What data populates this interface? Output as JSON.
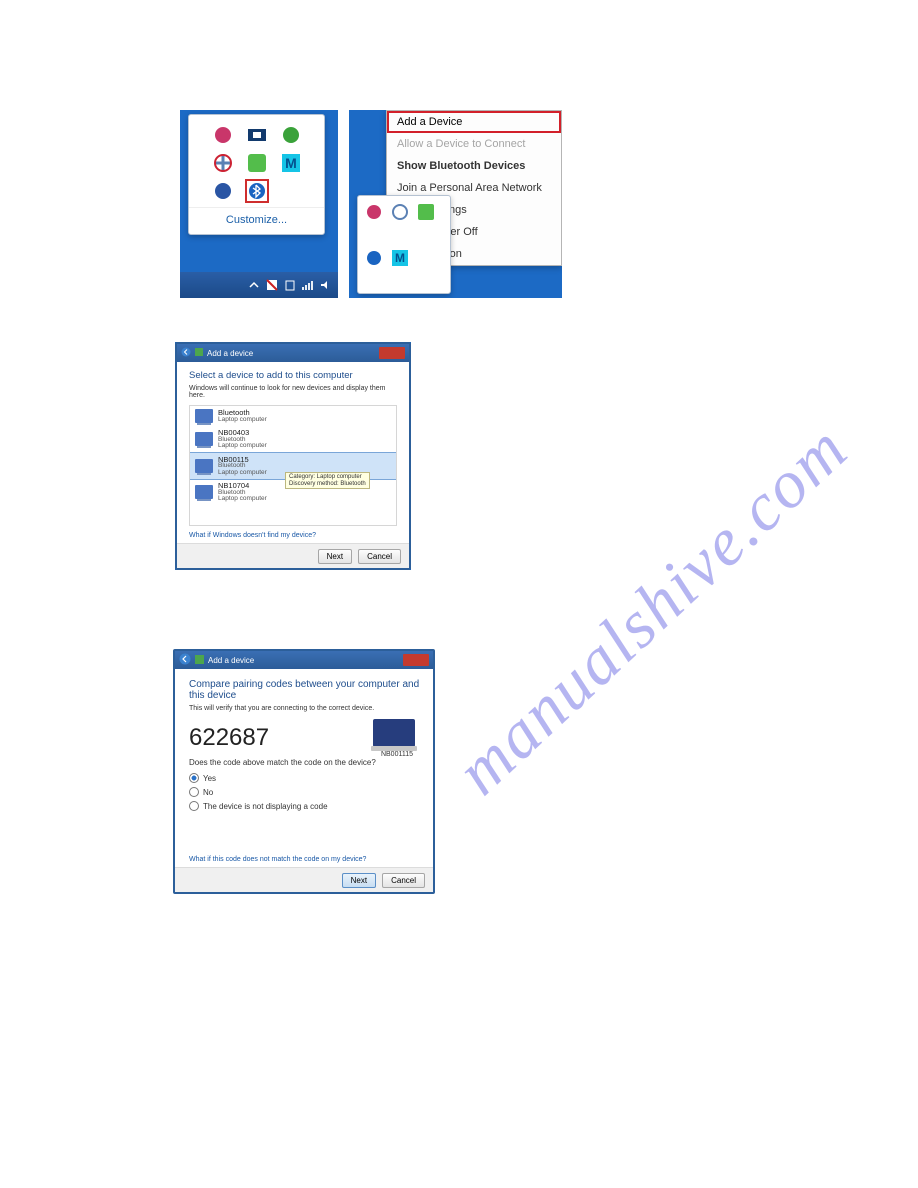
{
  "watermark": "manualshive.com",
  "shot1": {
    "customize": "Customize...",
    "icons": [
      "app1",
      "app2",
      "app3",
      "app4",
      "app5",
      "M-icon",
      "globe",
      "bluetooth"
    ]
  },
  "shot2": {
    "menu": [
      "Add a Device",
      "Allow a Device to Connect",
      "Show Bluetooth Devices",
      "Join a Personal Area Network",
      "Open Settings",
      "Turn Adapter Off",
      "Remove Icon"
    ]
  },
  "shot3": {
    "title": "Add a device",
    "heading": "Select a device to add to this computer",
    "subtitle": "Windows will continue to look for new devices and display them here.",
    "devices": [
      {
        "name": "Bluetooth",
        "sub": "Laptop computer"
      },
      {
        "name": "NB00403",
        "sub": "Bluetooth",
        "sub2": "Laptop computer"
      },
      {
        "name": "NB00115",
        "sub": "Bluetooth",
        "sub2": "Laptop computer"
      },
      {
        "name": "NB10704",
        "sub": "Bluetooth",
        "sub2": "Laptop computer"
      }
    ],
    "tooltip": [
      "Category: Laptop computer",
      "Discovery method: Bluetooth"
    ],
    "link": "What if Windows doesn't find my device?",
    "next": "Next",
    "cancel": "Cancel"
  },
  "shot4": {
    "title": "Add a device",
    "heading": "Compare pairing codes between your computer and this device",
    "verify": "This will verify that you are connecting to the correct device.",
    "code": "622687",
    "question": "Does the code above match the code on the device?",
    "opt_yes": "Yes",
    "opt_no": "No",
    "opt_na": "The device is not displaying a code",
    "device_name": "NB001115",
    "link": "What if this code does not match the code on my device?",
    "next": "Next",
    "cancel": "Cancel"
  }
}
